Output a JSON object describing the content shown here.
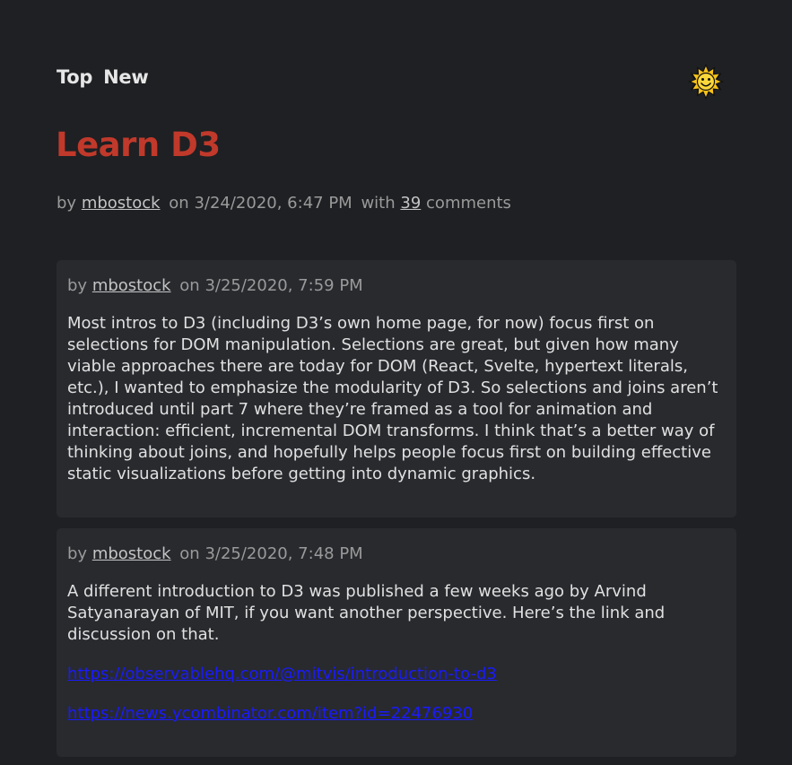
{
  "nav": {
    "top_label": "Top",
    "new_label": "New"
  },
  "theme_icon": "sun-face-icon",
  "story": {
    "title": "Learn D3",
    "by_prefix": "by",
    "author": "mbostock",
    "date": "on 3/24/2020, 6:47 PM",
    "with_prefix": "with",
    "comment_count": "39",
    "comments_suffix": "comments"
  },
  "comments": [
    {
      "by_prefix": "by",
      "author": "mbostock",
      "date": "on 3/25/2020, 7:59 PM",
      "paragraphs": [
        "Most intros to D3 (including D3’s own home page, for now) focus first on selections for DOM manipulation. Selections are great, but given how many viable approaches there are today for DOM (React, Svelte, hypertext literals, etc.), I wanted to emphasize the modularity of D3. So selections and joins aren’t introduced until part 7 where they’re framed as a tool for animation and interaction: efficient, incremental DOM transforms. I think that’s a better way of thinking about joins, and hopefully helps people focus first on building effective static visualizations before getting into dynamic graphics."
      ]
    },
    {
      "by_prefix": "by",
      "author": "mbostock",
      "date": "on 3/25/2020, 7:48 PM",
      "paragraphs": [
        "A different introduction to D3 was published a few weeks ago by Arvind Satyanarayan of MIT, if you want another perspective. Here’s the link and discussion on that."
      ],
      "links": [
        "https://observablehq.com/@mitvis/introduction-to-d3",
        "https://news.ycombinator.com/item?id=22476930"
      ]
    }
  ],
  "colors": {
    "background": "#1e2023",
    "card": "#282a2e",
    "title": "#c0392b",
    "link": "#1a1aff"
  }
}
